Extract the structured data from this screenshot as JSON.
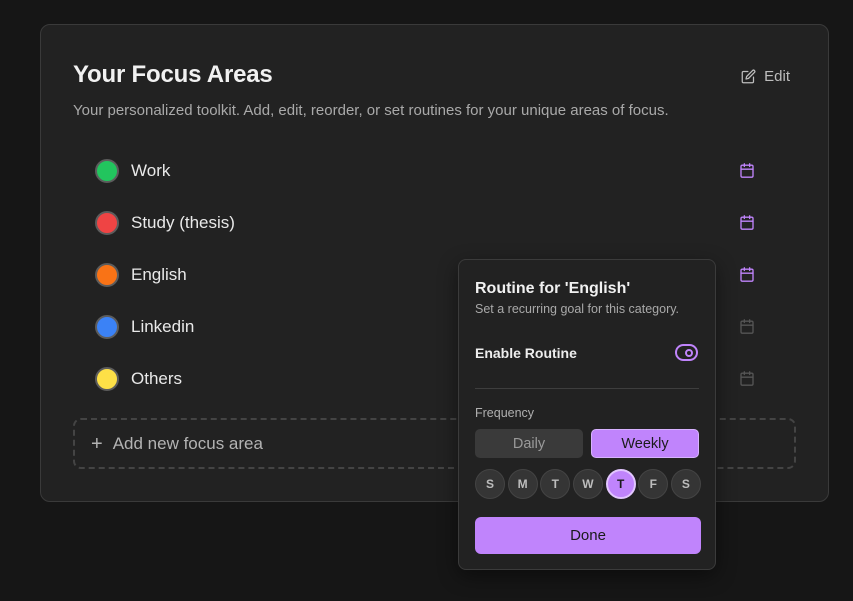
{
  "card": {
    "title": "Your Focus Areas",
    "edit_label": "Edit",
    "subtitle": "Your personalized toolkit. Add, edit, reorder, or set routines for your unique areas of focus.",
    "add_label": "Add new focus area"
  },
  "focus_areas": [
    {
      "label": "Work",
      "color": "#22c55e",
      "routine_icon": "calendar-icon",
      "highlighted": true
    },
    {
      "label": "Study (thesis)",
      "color": "#ef4444",
      "routine_icon": "calendar-icon",
      "highlighted": true
    },
    {
      "label": "English",
      "color": "#f97316",
      "routine_icon": "calendar-icon",
      "highlighted": true
    },
    {
      "label": "Linkedin",
      "color": "#3b82f6",
      "routine_icon": "calendar-icon",
      "highlighted": false
    },
    {
      "label": "Others",
      "color": "#fde047",
      "routine_icon": "calendar-icon",
      "highlighted": false
    }
  ],
  "routine_popover": {
    "title": "Routine for 'English'",
    "subtitle": "Set a recurring goal for this category.",
    "enable_label": "Enable Routine",
    "enabled": true,
    "frequency_label": "Frequency",
    "frequency_options": [
      "Daily",
      "Weekly"
    ],
    "frequency_selected": "Weekly",
    "days": [
      "S",
      "M",
      "T",
      "W",
      "T",
      "F",
      "S"
    ],
    "selected_day_index": 4,
    "done_label": "Done"
  },
  "colors": {
    "accent": "#c084fc",
    "background": "#161616",
    "card": "#222222"
  }
}
